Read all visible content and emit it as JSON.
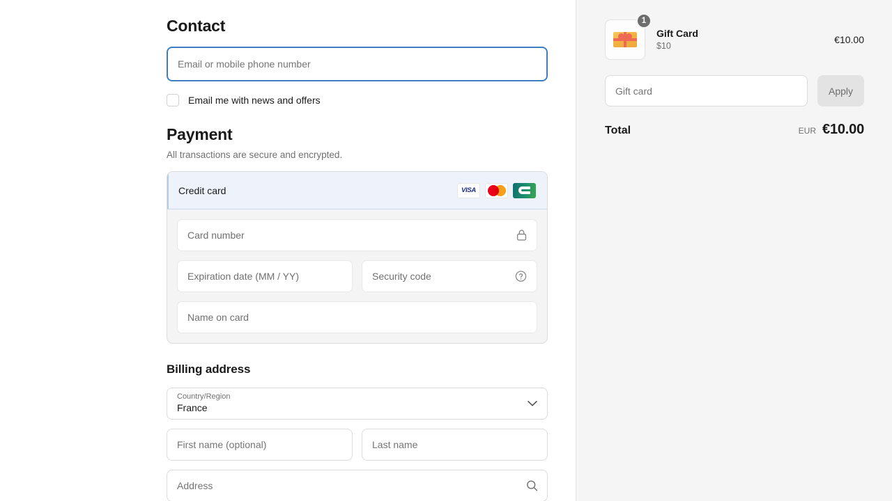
{
  "contact": {
    "heading": "Contact",
    "email_placeholder": "Email or mobile phone number",
    "email_value": "",
    "newsletter_label": "Email me with news and offers"
  },
  "payment": {
    "heading": "Payment",
    "subtext": "All transactions are secure and encrypted.",
    "method_label": "Credit card",
    "brands": [
      "visa-icon",
      "mastercard-icon",
      "cb-icon"
    ],
    "brand_labels": {
      "visa": "VISA"
    },
    "card_number_placeholder": "Card number",
    "card_number_value": "",
    "expiry_placeholder": "Expiration date (MM / YY)",
    "expiry_value": "",
    "security_placeholder": "Security code",
    "security_value": "",
    "name_placeholder": "Name on card",
    "name_value": "",
    "lock_icon": "lock-icon",
    "help_icon": "question-circle-icon"
  },
  "billing": {
    "heading": "Billing address",
    "country_label": "Country/Region",
    "country_value": "France",
    "first_name_placeholder": "First name (optional)",
    "first_name_value": "",
    "last_name_placeholder": "Last name",
    "last_name_value": "",
    "address_placeholder": "Address",
    "address_value": "",
    "chevron_icon": "chevron-down-icon",
    "search_icon": "search-icon"
  },
  "summary": {
    "item": {
      "title": "Gift Card",
      "variant": "$10",
      "price": "€10.00",
      "quantity": "1",
      "thumbnail_icon": "gift-card-image"
    },
    "gift_card_placeholder": "Gift card",
    "gift_card_value": "",
    "apply_label": "Apply",
    "total_label": "Total",
    "total_currency": "EUR",
    "total_amount": "€10.00"
  },
  "colors": {
    "focus_border": "#3d7fc1",
    "selected_method_bg": "#eef3fb",
    "summary_bg": "#f5f5f5",
    "payment_body_bg": "#f4f4f4",
    "badge_bg": "#6e6e6e",
    "apply_bg": "#e3e3e3"
  }
}
